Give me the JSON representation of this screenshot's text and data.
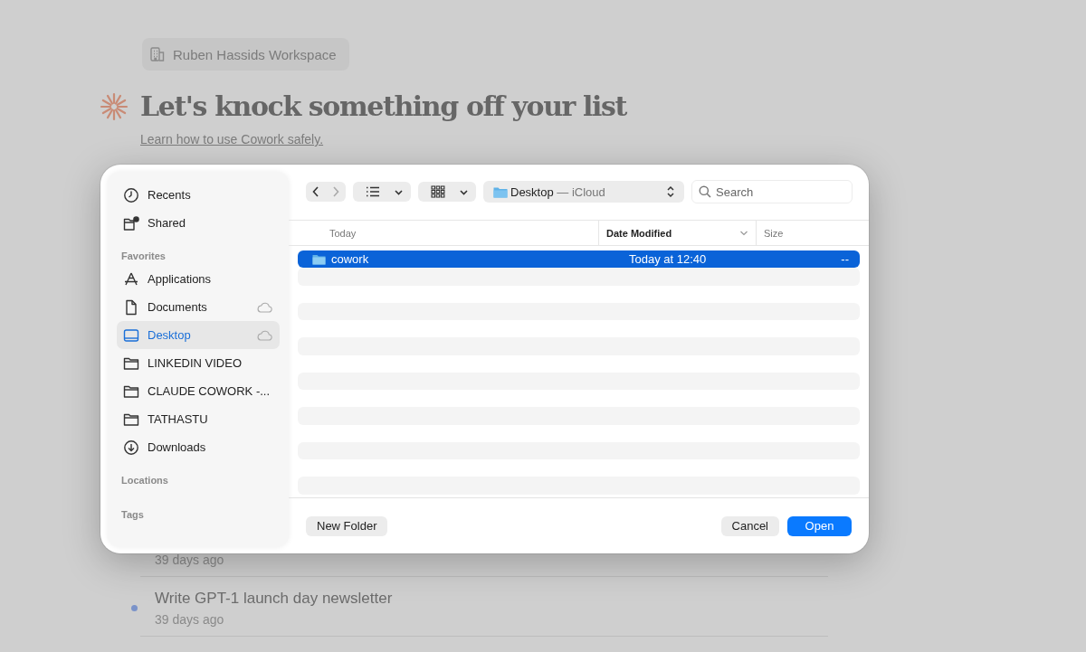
{
  "workspace": {
    "label": "Ruben Hassids Workspace"
  },
  "heading": "Let's knock something off your list",
  "safety_link": "Learn how to use Cowork safely.",
  "tasks": [
    {
      "time": "39 days ago"
    },
    {
      "title": "Write GPT-1 launch day newsletter",
      "time": "39 days ago",
      "color": "#7b93c9"
    }
  ],
  "dialog": {
    "sidebar": [
      {
        "items": [
          {
            "label": "Recents",
            "kind": "clock",
            "cloud": false,
            "selected": false
          },
          {
            "label": "Shared",
            "kind": "shared",
            "cloud": false,
            "selected": false
          }
        ]
      },
      {
        "title": "Favorites",
        "items": [
          {
            "label": "Applications",
            "kind": "apps",
            "cloud": false,
            "selected": false
          },
          {
            "label": "Documents",
            "kind": "document",
            "cloud": true,
            "selected": false
          },
          {
            "label": "Desktop",
            "kind": "desktop",
            "cloud": true,
            "selected": true
          },
          {
            "label": "LINKEDIN VIDEO",
            "kind": "folder",
            "cloud": false,
            "selected": false
          },
          {
            "label": "CLAUDE COWORK -...",
            "kind": "folder",
            "cloud": false,
            "selected": false
          },
          {
            "label": "TATHASTU",
            "kind": "folder",
            "cloud": false,
            "selected": false
          },
          {
            "label": "Downloads",
            "kind": "download",
            "cloud": false,
            "selected": false
          }
        ]
      },
      {
        "title": "Locations"
      },
      {
        "title": "Tags"
      }
    ],
    "location": {
      "name": "Desktop",
      "suffix": "— iCloud"
    },
    "search": {
      "placeholder": "Search"
    },
    "columns": [
      {
        "label": "Today",
        "sorted": false
      },
      {
        "label": "Date Modified",
        "sorted": true
      },
      {
        "label": "Size",
        "sorted": false
      }
    ],
    "rows": [
      {
        "name": "cowork",
        "date": "Today at 12:40",
        "size": "--",
        "selected": true
      }
    ],
    "buttons": [
      {
        "label": "New Folder",
        "kind": "secondary"
      },
      {
        "label": "Cancel",
        "kind": "secondary"
      },
      {
        "label": "Open",
        "kind": "primary"
      }
    ]
  }
}
